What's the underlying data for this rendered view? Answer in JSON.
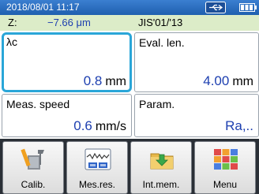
{
  "status_bar": {
    "timestamp": "2018/08/01 11:17",
    "icons": [
      "usb-icon",
      "battery-icon"
    ]
  },
  "z_row": {
    "label": "Z:",
    "value": "−7.66 μm",
    "standard": "JIS'01/'13"
  },
  "cards": {
    "cutoff": {
      "label": "λc",
      "value": "0.8",
      "unit": "mm"
    },
    "eval_length": {
      "label": "Eval. len.",
      "value": "4.00",
      "unit": "mm"
    },
    "meas_speed": {
      "label": "Meas. speed",
      "value": "0.6",
      "unit": "mm/s"
    },
    "param": {
      "label": "Param.",
      "value": "Ra,.."
    }
  },
  "buttons": {
    "calib": {
      "label": "Calib.",
      "icon": "calibration-tools-icon"
    },
    "mes_res": {
      "label": "Mes.res.",
      "icon": "waveform-result-icon"
    },
    "int_mem": {
      "label": "Int.mem.",
      "icon": "folder-save-icon"
    },
    "menu": {
      "label": "Menu",
      "icon": "menu-grid-icon"
    }
  },
  "colors": {
    "status_bar": "#1f5faf",
    "info_row": "#dcecc8",
    "value_text": "#1d3fb0",
    "selected_border": "#2aa6d8",
    "button_bar": "#2a2f36"
  }
}
